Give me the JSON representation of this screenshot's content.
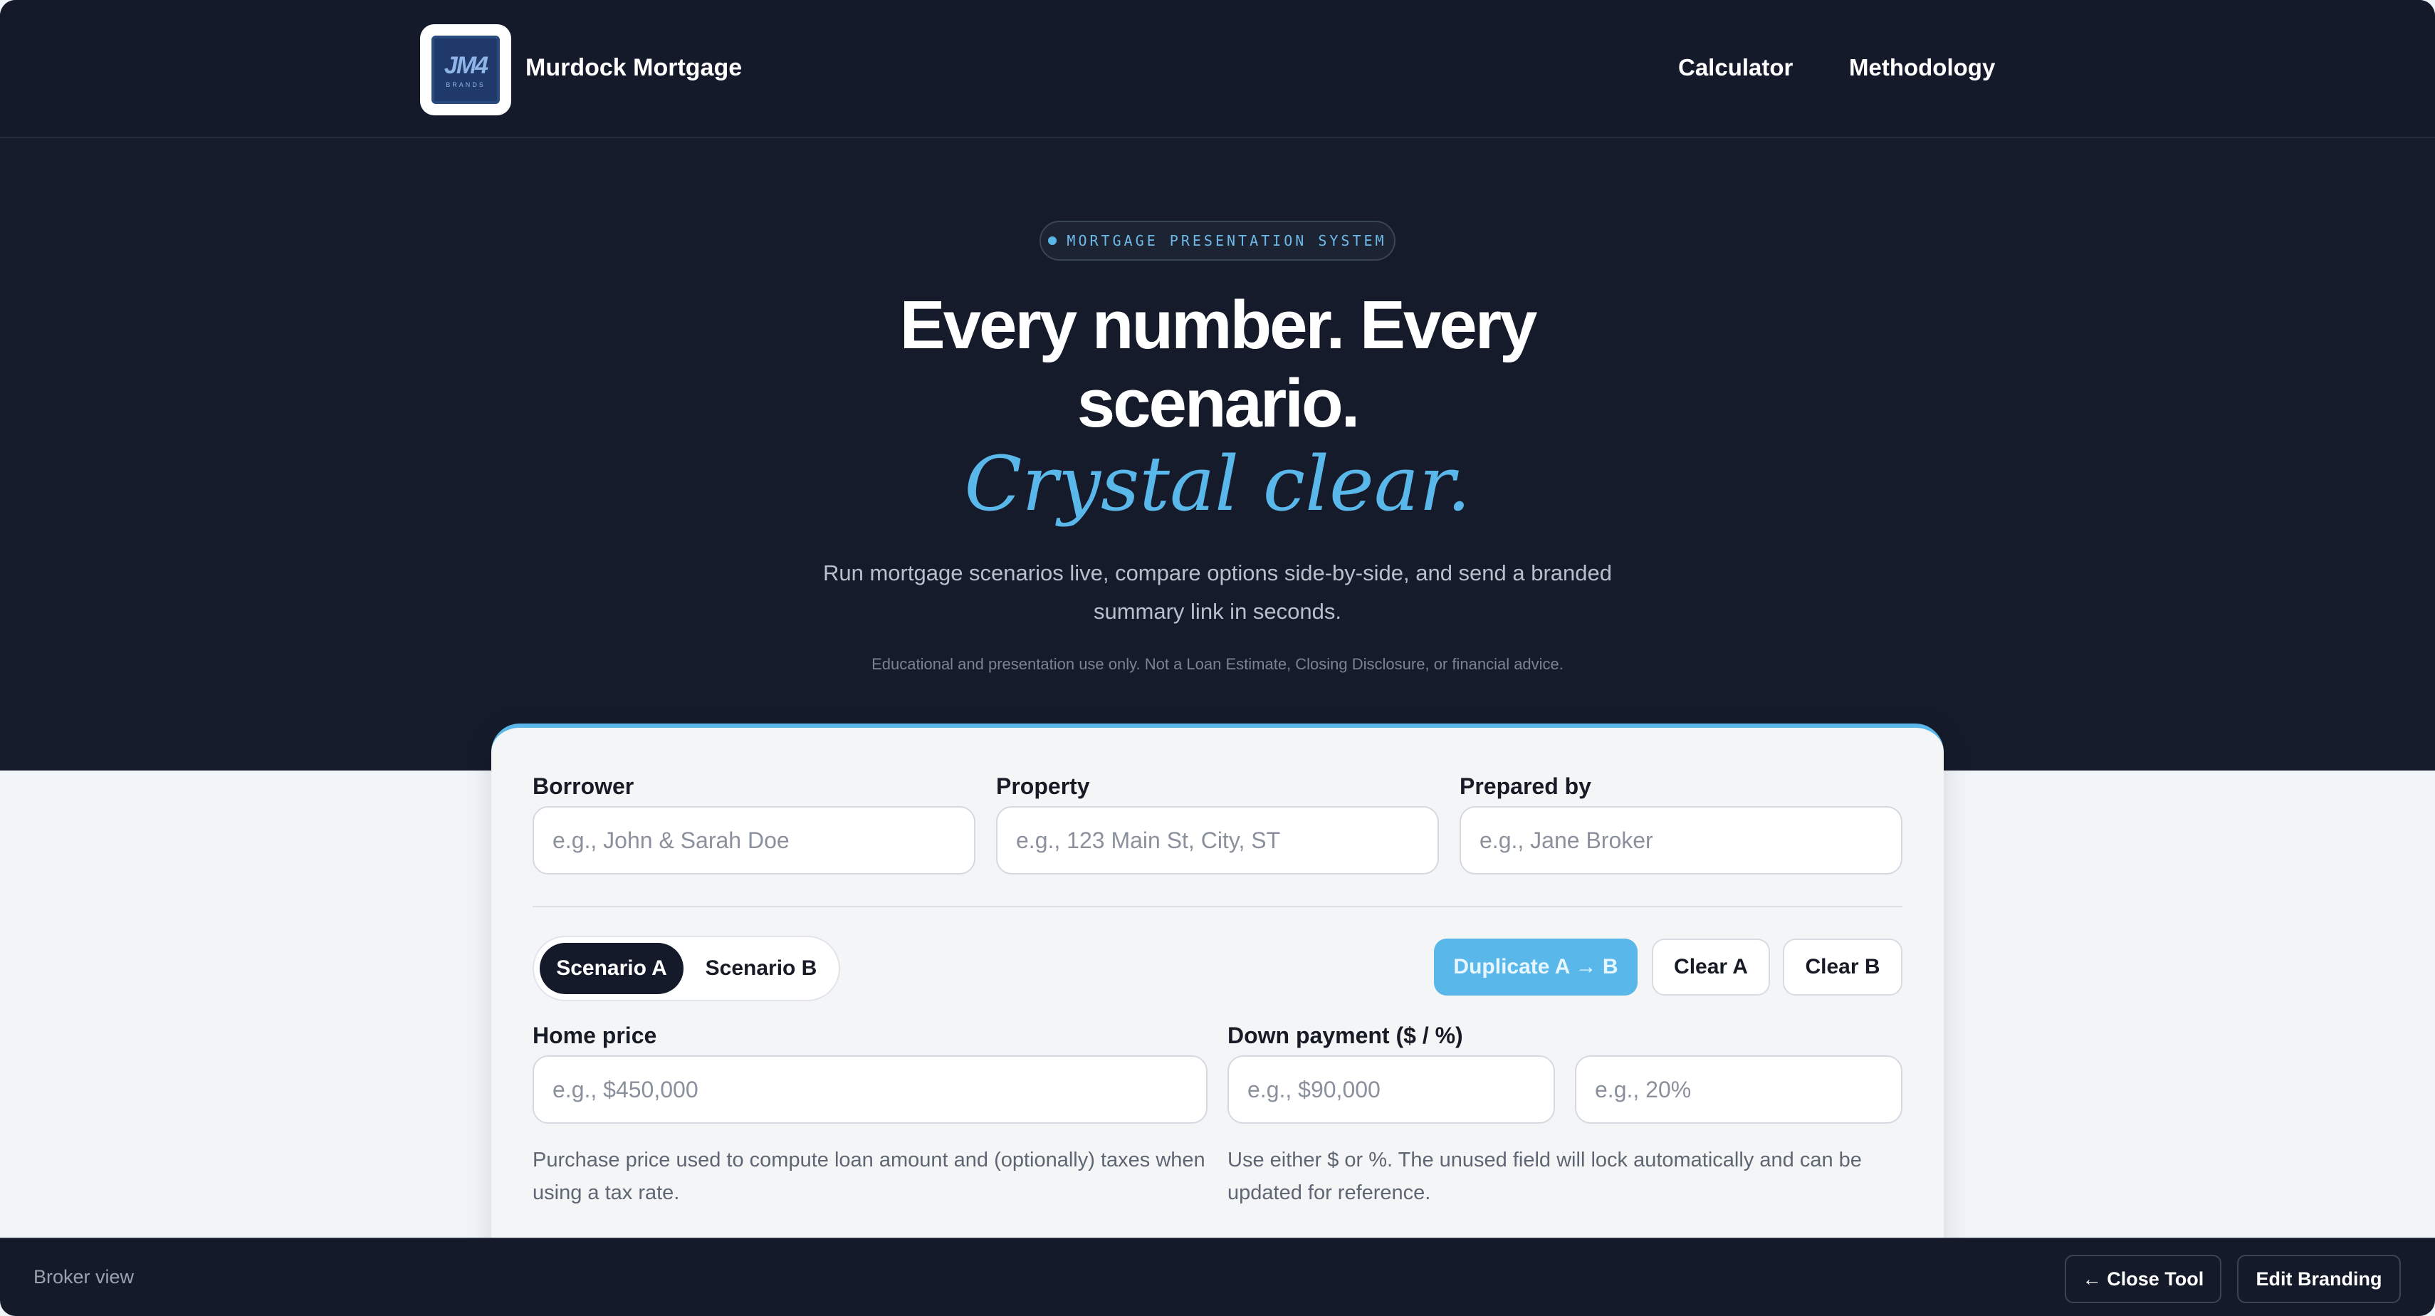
{
  "header": {
    "brand_name": "Murdock Mortgage",
    "logo_mark": "JM4",
    "logo_sub": "BRANDS",
    "nav": [
      {
        "label": "Calculator"
      },
      {
        "label": "Methodology"
      }
    ]
  },
  "hero": {
    "pill_label": "MORTGAGE PRESENTATION SYSTEM",
    "title": "Every number. Every scenario.",
    "accent": "Crystal clear.",
    "subtitle": "Run mortgage scenarios live, compare options side-by-side, and send a branded summary link in seconds.",
    "disclaimer": "Educational and presentation use only. Not a Loan Estimate, Closing Disclosure, or financial advice."
  },
  "form": {
    "borrower": {
      "label": "Borrower",
      "placeholder": "e.g., John & Sarah Doe",
      "value": ""
    },
    "property": {
      "label": "Property",
      "placeholder": "e.g., 123 Main St, City, ST",
      "value": ""
    },
    "prepared_by": {
      "label": "Prepared by",
      "placeholder": "e.g., Jane Broker",
      "value": ""
    },
    "scenarios": {
      "tabs": [
        "Scenario A",
        "Scenario B"
      ],
      "selected": "Scenario A"
    },
    "actions": {
      "duplicate": "Duplicate A → B",
      "clear_a": "Clear A",
      "clear_b": "Clear B"
    },
    "home_price": {
      "label": "Home price",
      "placeholder": "e.g., $450,000",
      "value": "",
      "help": "Purchase price used to compute loan amount and (optionally) taxes when using a tax rate."
    },
    "down_payment": {
      "label": "Down payment ($ / %)",
      "placeholder_amount": "e.g., $90,000",
      "placeholder_percent": "e.g., 20%",
      "value_amount": "",
      "value_percent": "",
      "help": "Use either $ or %. The unused field will lock automatically and can be updated for reference."
    }
  },
  "footer": {
    "mode_label": "Broker view",
    "close_tool": "← Close Tool",
    "edit_branding": "Edit Branding"
  },
  "colors": {
    "dark_bg": "#151b2a",
    "accent": "#5ab7ea",
    "page_bg": "#f1f4f8",
    "card_bg": "#f4f5f6"
  }
}
